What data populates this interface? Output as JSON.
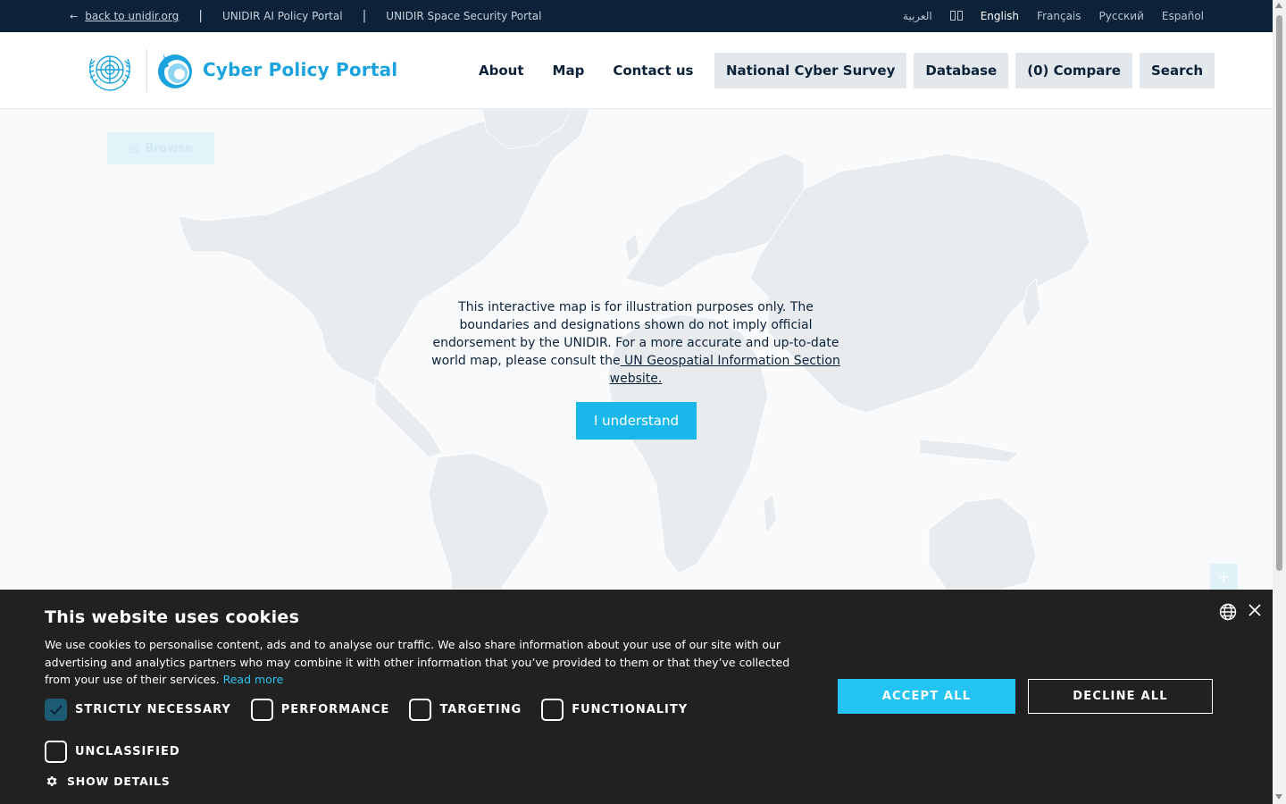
{
  "topbar": {
    "back_arrow": "←",
    "back_link": "back to unidir.org",
    "separator": "|",
    "ai_portal": "UNIDIR AI Policy Portal",
    "space_portal": "UNIDIR Space Security Portal",
    "languages": {
      "arabic": "العربية",
      "english": "English",
      "french": "Français",
      "russian": "Русский",
      "spanish": "Español"
    },
    "active_language": "English"
  },
  "header": {
    "title": "Cyber Policy Portal",
    "nav": {
      "about": "About",
      "map": "Map",
      "contact": "Contact us"
    },
    "buttons": {
      "survey": "National Cyber Survey",
      "database": "Database",
      "compare": "(0) Compare",
      "search": "Search"
    }
  },
  "map": {
    "browse_label": "Browse",
    "notice_text": "This interactive map is for illustration purposes only. The boundaries and designations shown do not imply official endorsement by the UNIDIR. For a more accurate and up-to-date world map, please consult the",
    "notice_link": " UN Geospatial Information Section website.",
    "understand_label": "I understand",
    "zoom_in_label": "+"
  },
  "cookie": {
    "title": "This website uses cookies",
    "text": "We use cookies to personalise content, ads and to analyse our traffic. We also share information about your use of our site with our advertising and analytics partners who may combine it with other information that you’ve provided to them or that they’ve collected from your use of their services.",
    "read_more": "Read more",
    "categories": {
      "strictly": "STRICTLY NECESSARY",
      "performance": "PERFORMANCE",
      "targeting": "TARGETING",
      "functionality": "FUNCTIONALITY",
      "unclassified": "UNCLASSIFIED"
    },
    "show_details": "SHOW DETAILS",
    "accept_all": "ACCEPT ALL",
    "decline_all": "DECLINE ALL"
  },
  "colors": {
    "topbar_bg": "#0c2239",
    "brand_blue": "#1aa3dd",
    "accent_cyan": "#23c4f3",
    "cookie_bg": "#212121",
    "land": "#e9ecef"
  }
}
